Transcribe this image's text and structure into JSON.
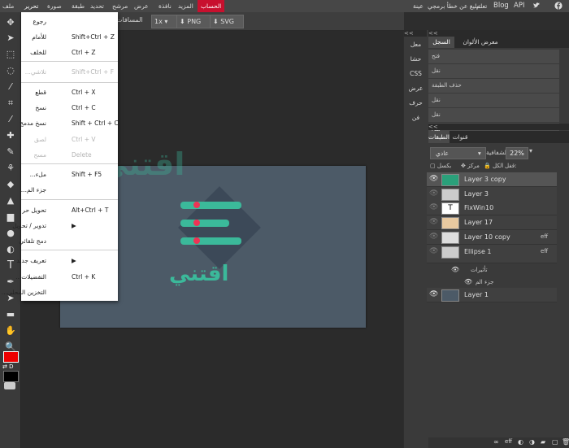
{
  "menubar": {
    "items_ltr": [
      "ملف",
      "تحرير",
      "صورة",
      "طبقة",
      "تحديد",
      "مرشح",
      "عرض",
      "نافذة",
      "المزيد",
      "الحساب"
    ],
    "right_links": [
      "عينة",
      "تبليغ عن خطأ برمجي",
      "تعلم",
      "Blog",
      "API"
    ]
  },
  "options": {
    "spacing_label": "المسافات",
    "zoom": "1x",
    "png": "PNG",
    "svg": "SVG"
  },
  "dropdown": {
    "items": [
      {
        "label": "رجوع",
        "shortcut": "",
        "disabled": false
      },
      {
        "label": "للأمام",
        "shortcut": "Shift+Ctrl + Z",
        "disabled": false
      },
      {
        "label": "للخلف",
        "shortcut": "Ctrl + Z",
        "disabled": false
      },
      {
        "label": "تلاشي...",
        "shortcut": "Shift+Ctrl + F",
        "disabled": true
      },
      {
        "label": "قطع",
        "shortcut": "Ctrl + X",
        "disabled": false
      },
      {
        "label": "نسخ",
        "shortcut": "Ctrl + C",
        "disabled": false
      },
      {
        "label": "نسخ مدمج",
        "shortcut": "Shift + Ctrl + C",
        "disabled": false
      },
      {
        "label": "لصق",
        "shortcut": "Ctrl + V",
        "disabled": true
      },
      {
        "label": "مسح",
        "shortcut": "Delete",
        "disabled": true
      },
      {
        "label": "ملء...",
        "shortcut": "Shift + F5",
        "disabled": false
      },
      {
        "label": "جزء الم...",
        "shortcut": "",
        "disabled": false
      },
      {
        "label": "تحويل حر",
        "shortcut": "Alt+Ctrl + T",
        "disabled": false
      },
      {
        "label": "تدوير / تحويل",
        "shortcut": "▶",
        "disabled": false
      },
      {
        "label": "دمج تلقائي",
        "shortcut": "",
        "disabled": false
      },
      {
        "label": "تعريف جديد",
        "shortcut": "▶",
        "disabled": false
      },
      {
        "label": "التفضيلات...",
        "shortcut": "Ctrl + K",
        "disabled": false
      },
      {
        "label": "التخزين المحلي...",
        "shortcut": "",
        "disabled": false
      }
    ]
  },
  "history": {
    "tabs": [
      "معرض الألوان",
      "السجل"
    ],
    "rows": [
      "فتح",
      "نقل",
      "حذف الطبقة",
      "نقل",
      "نقل",
      "نقل"
    ]
  },
  "side_tabs": [
    "معل",
    "حشا",
    "CSS",
    "عرض",
    "حرف",
    "فن"
  ],
  "layers": {
    "tabs": [
      "قنوات",
      "الطبقات"
    ],
    "blend_mode": "عادي",
    "opacity_label": "الشفافية:",
    "opacity_value": "22%",
    "lock_label": "قفل:",
    "lock_opts": [
      "بكسل",
      "مركز",
      "الكل"
    ],
    "items": [
      {
        "name": "Layer 3 copy",
        "fx": ""
      },
      {
        "name": "Layer 3",
        "fx": ""
      },
      {
        "name": "FixWin10",
        "fx": ""
      },
      {
        "name": "Layer 17",
        "fx": ""
      },
      {
        "name": "Layer 10 copy",
        "fx": "eff"
      },
      {
        "name": "Ellipse 1",
        "fx": "eff"
      }
    ],
    "ellipse_effects": [
      "تأثيرات",
      "جزء الم"
    ],
    "last": "Layer 1"
  },
  "watermark": "اقتني"
}
